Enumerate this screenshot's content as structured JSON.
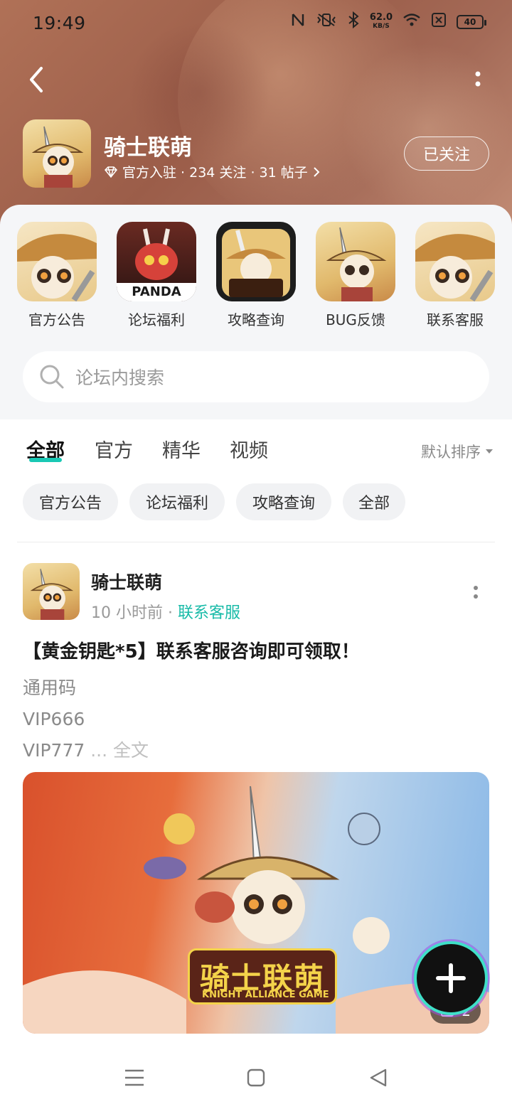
{
  "status_bar": {
    "time": "19:49",
    "net_speed_value": "62.0",
    "net_speed_unit": "KB/S",
    "battery": "40"
  },
  "forum": {
    "title": "骑士联萌",
    "meta": "官方入驻 · 234 关注 · 31 帖子",
    "follow_label": "已关注"
  },
  "quick_links": [
    {
      "label": "官方公告"
    },
    {
      "label": "论坛福利",
      "badge": "PANDA"
    },
    {
      "label": "攻略查询"
    },
    {
      "label": "BUG反馈"
    },
    {
      "label": "联系客服"
    }
  ],
  "search": {
    "placeholder": "论坛内搜索"
  },
  "tabs": [
    "全部",
    "官方",
    "精华",
    "视频"
  ],
  "sort_label": "默认排序",
  "chips": [
    "官方公告",
    "论坛福利",
    "攻略查询",
    "全部"
  ],
  "post": {
    "author": "骑士联萌",
    "time": "10 小时前",
    "dot": "·",
    "tag": "联系客服",
    "title": "【黄金钥匙*5】联系客服咨询即可领取！",
    "lines": [
      "通用码",
      "VIP666",
      "VIP777"
    ],
    "more": " ... 全文",
    "image_title": "骑士联萌",
    "image_subtitle": "KNIGHT ALLIANCE GAME",
    "image_count": "2"
  },
  "colors": {
    "accent": "#19c8b4",
    "header": "#a46450"
  }
}
